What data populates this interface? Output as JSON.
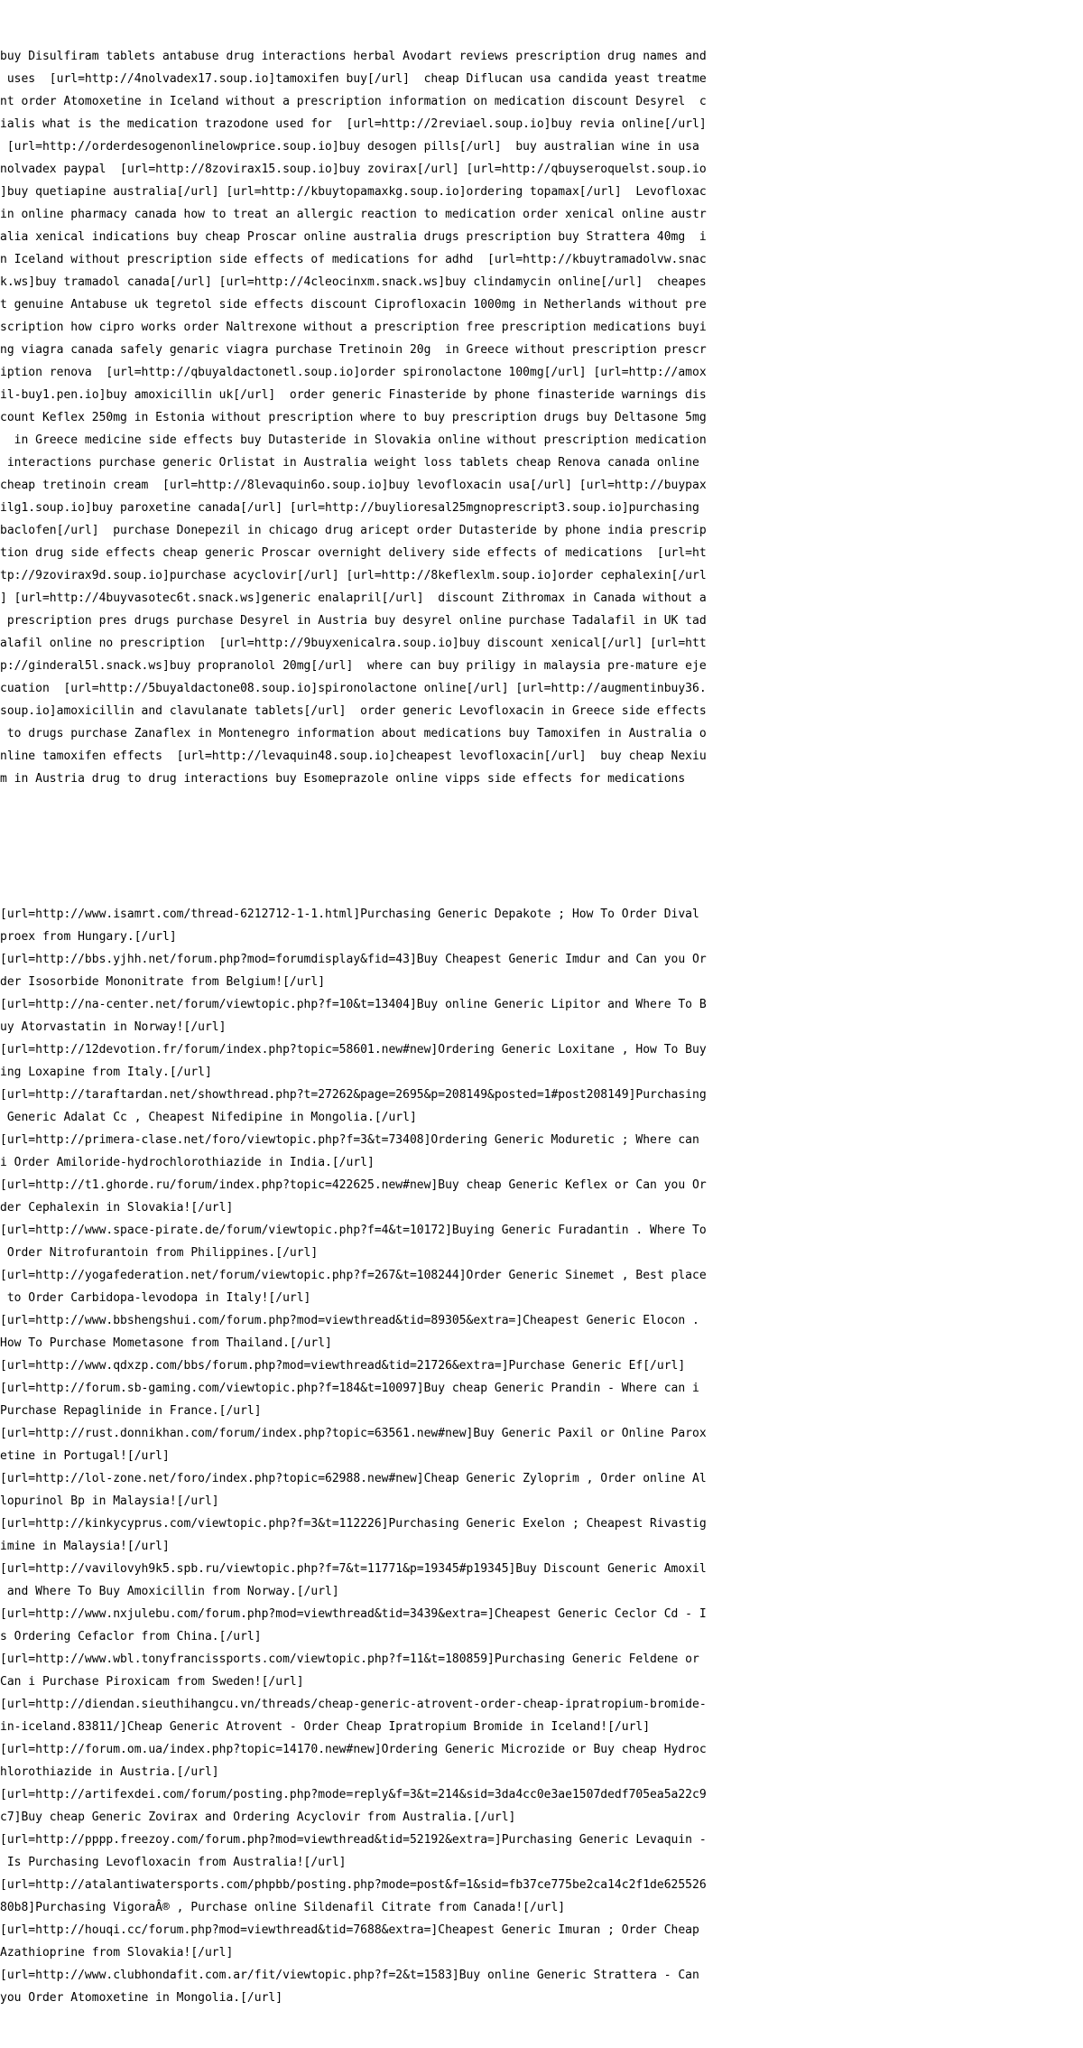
{
  "spam_paragraph": [
    "buy Disulfiram tablets antabuse drug interactions herbal Avodart reviews prescription drug names and",
    " uses  [url=http://4nolvadex17.soup.io]tamoxifen buy[/url]  cheap Diflucan usa candida yeast treatme",
    "nt order Atomoxetine in Iceland without a prescription information on medication discount Desyrel  c",
    "ialis what is the medication trazodone used for  [url=http://2reviael.soup.io]buy revia online[/url]",
    " [url=http://orderdesogenonlinelowprice.soup.io]buy desogen pills[/url]  buy australian wine in usa ",
    "nolvadex paypal  [url=http://8zovirax15.soup.io]buy zovirax[/url] [url=http://qbuyseroquelst.soup.io",
    "]buy quetiapine australia[/url] [url=http://kbuytopamaxkg.soup.io]ordering topamax[/url]  Levofloxac",
    "in online pharmacy canada how to treat an allergic reaction to medication order xenical online austr",
    "alia xenical indications buy cheap Proscar online australia drugs prescription buy Strattera 40mg  i",
    "n Iceland without prescription side effects of medications for adhd  [url=http://kbuytramadolvw.snac",
    "k.ws]buy tramadol canada[/url] [url=http://4cleocinxm.snack.ws]buy clindamycin online[/url]  cheapes",
    "t genuine Antabuse uk tegretol side effects discount Ciprofloxacin 1000mg in Netherlands without pre",
    "scription how cipro works order Naltrexone without a prescription free prescription medications buyi",
    "ng viagra canada safely genaric viagra purchase Tretinoin 20g  in Greece without prescription prescr",
    "iption renova  [url=http://qbuyaldactonetl.soup.io]order spironolactone 100mg[/url] [url=http://amox",
    "il-buy1.pen.io]buy amoxicillin uk[/url]  order generic Finasteride by phone finasteride warnings dis",
    "count Keflex 250mg in Estonia without prescription where to buy prescription drugs buy Deltasone 5mg",
    "  in Greece medicine side effects buy Dutasteride in Slovakia online without prescription medication",
    " interactions purchase generic Orlistat in Australia weight loss tablets cheap Renova canada online ",
    "cheap tretinoin cream  [url=http://8levaquin6o.soup.io]buy levofloxacin usa[/url] [url=http://buypax",
    "ilg1.soup.io]buy paroxetine canada[/url] [url=http://buylioresal25mgnoprescript3.soup.io]purchasing ",
    "baclofen[/url]  purchase Donepezil in chicago drug aricept order Dutasteride by phone india prescrip",
    "tion drug side effects cheap generic Proscar overnight delivery side effects of medications  [url=ht",
    "tp://9zovirax9d.soup.io]purchase acyclovir[/url] [url=http://8keflexlm.soup.io]order cephalexin[/url",
    "] [url=http://4buyvasotec6t.snack.ws]generic enalapril[/url]  discount Zithromax in Canada without a",
    " prescription pres drugs purchase Desyrel in Austria buy desyrel online purchase Tadalafil in UK tad",
    "alafil online no prescription  [url=http://9buyxenicalra.soup.io]buy discount xenical[/url] [url=htt",
    "p://ginderal5l.snack.ws]buy propranolol 20mg[/url]  where can buy priligy in malaysia pre-mature eje",
    "cuation  [url=http://5buyaldactone08.soup.io]spironolactone online[/url] [url=http://augmentinbuy36.",
    "soup.io]amoxicillin and clavulanate tablets[/url]  order generic Levofloxacin in Greece side effects",
    " to drugs purchase Zanaflex in Montenegro information about medications buy Tamoxifen in Australia o",
    "nline tamoxifen effects  [url=http://levaquin48.soup.io]cheapest levofloxacin[/url]  buy cheap Nexiu",
    "m in Austria drug to drug interactions buy Esomeprazole online vipps side effects for medications"
  ],
  "forum_links": [
    "[url=http://www.isamrt.com/thread-6212712-1-1.html]Purchasing Generic Depakote ; How To Order Dival",
    "proex from Hungary.[/url]",
    "[url=http://bbs.yjhh.net/forum.php?mod=forumdisplay&fid=43]Buy Cheapest Generic Imdur and Can you Or",
    "der Isosorbide Mononitrate from Belgium![/url]",
    "[url=http://na-center.net/forum/viewtopic.php?f=10&t=13404]Buy online Generic Lipitor and Where To B",
    "uy Atorvastatin in Norway![/url]",
    "[url=http://12devotion.fr/forum/index.php?topic=58601.new#new]Ordering Generic Loxitane , How To Buy",
    "ing Loxapine from Italy.[/url]",
    "[url=http://taraftardan.net/showthread.php?t=27262&page=2695&p=208149&posted=1#post208149]Purchasing",
    " Generic Adalat Cc , Cheapest Nifedipine in Mongolia.[/url]",
    "[url=http://primera-clase.net/foro/viewtopic.php?f=3&t=73408]Ordering Generic Moduretic ; Where can",
    "i Order Amiloride-hydrochlorothiazide in India.[/url]",
    "[url=http://t1.ghorde.ru/forum/index.php?topic=422625.new#new]Buy cheap Generic Keflex or Can you Or",
    "der Cephalexin in Slovakia![/url]",
    "[url=http://www.space-pirate.de/forum/viewtopic.php?f=4&t=10172]Buying Generic Furadantin . Where To",
    " Order Nitrofurantoin from Philippines.[/url]",
    "[url=http://yogafederation.net/forum/viewtopic.php?f=267&t=108244]Order Generic Sinemet , Best place",
    " to Order Carbidopa-levodopa in Italy![/url]",
    "[url=http://www.bbshengshui.com/forum.php?mod=viewthread&tid=89305&extra=]Cheapest Generic Elocon .",
    "How To Purchase Mometasone from Thailand.[/url]",
    "[url=http://www.qdxzp.com/bbs/forum.php?mod=viewthread&tid=21726&extra=]Purchase Generic Ef[/url]",
    "[url=http://forum.sb-gaming.com/viewtopic.php?f=184&t=10097]Buy cheap Generic Prandin - Where can i",
    "Purchase Repaglinide in France.[/url]",
    "[url=http://rust.donnikhan.com/forum/index.php?topic=63561.new#new]Buy Generic Paxil or Online Parox",
    "etine in Portugal![/url]",
    "[url=http://lol-zone.net/foro/index.php?topic=62988.new#new]Cheap Generic Zyloprim , Order online Al",
    "lopurinol Bp in Malaysia![/url]",
    "[url=http://kinkycyprus.com/viewtopic.php?f=3&t=112226]Purchasing Generic Exelon ; Cheapest Rivastig",
    "imine in Malaysia![/url]",
    "[url=http://vavilovyh9k5.spb.ru/viewtopic.php?f=7&t=11771&p=19345#p19345]Buy Discount Generic Amoxil",
    " and Where To Buy Amoxicillin from Norway.[/url]",
    "[url=http://www.nxjulebu.com/forum.php?mod=viewthread&tid=3439&extra=]Cheapest Generic Ceclor Cd - I",
    "s Ordering Cefaclor from China.[/url]",
    "[url=http://www.wbl.tonyfrancissports.com/viewtopic.php?f=11&t=180859]Purchasing Generic Feldene or",
    "Can i Purchase Piroxicam from Sweden![/url]",
    "[url=http://diendan.sieuthihangcu.vn/threads/cheap-generic-atrovent-order-cheap-ipratropium-bromide-",
    "in-iceland.83811/]Cheap Generic Atrovent - Order Cheap Ipratropium Bromide in Iceland![/url]",
    "[url=http://forum.om.ua/index.php?topic=14170.new#new]Ordering Generic Microzide or Buy cheap Hydroc",
    "hlorothiazide in Austria.[/url]",
    "[url=http://artifexdei.com/forum/posting.php?mode=reply&f=3&t=214&sid=3da4cc0e3ae1507dedf705ea5a22c9",
    "c7]Buy cheap Generic Zovirax and Ordering Acyclovir from Australia.[/url]",
    "[url=http://pppp.freezoy.com/forum.php?mod=viewthread&tid=52192&extra=]Purchasing Generic Levaquin -",
    " Is Purchasing Levofloxacin from Australia![/url]",
    "[url=http://atalantiwatersports.com/phpbb/posting.php?mode=post&f=1&sid=fb37ce775be2ca14c2f1de625526",
    "80b8]Purchasing VigoraÂ® , Purchase online Sildenafil Citrate from Canada![/url]",
    "[url=http://houqi.cc/forum.php?mod=viewthread&tid=7688&extra=]Cheapest Generic Imuran ; Order Cheap",
    "Azathioprine from Slovakia![/url]",
    "[url=http://www.clubhondafit.com.ar/fit/viewtopic.php?f=2&t=1583]Buy online Generic Strattera - Can",
    "you Order Atomoxetine in Mongolia.[/url]"
  ]
}
